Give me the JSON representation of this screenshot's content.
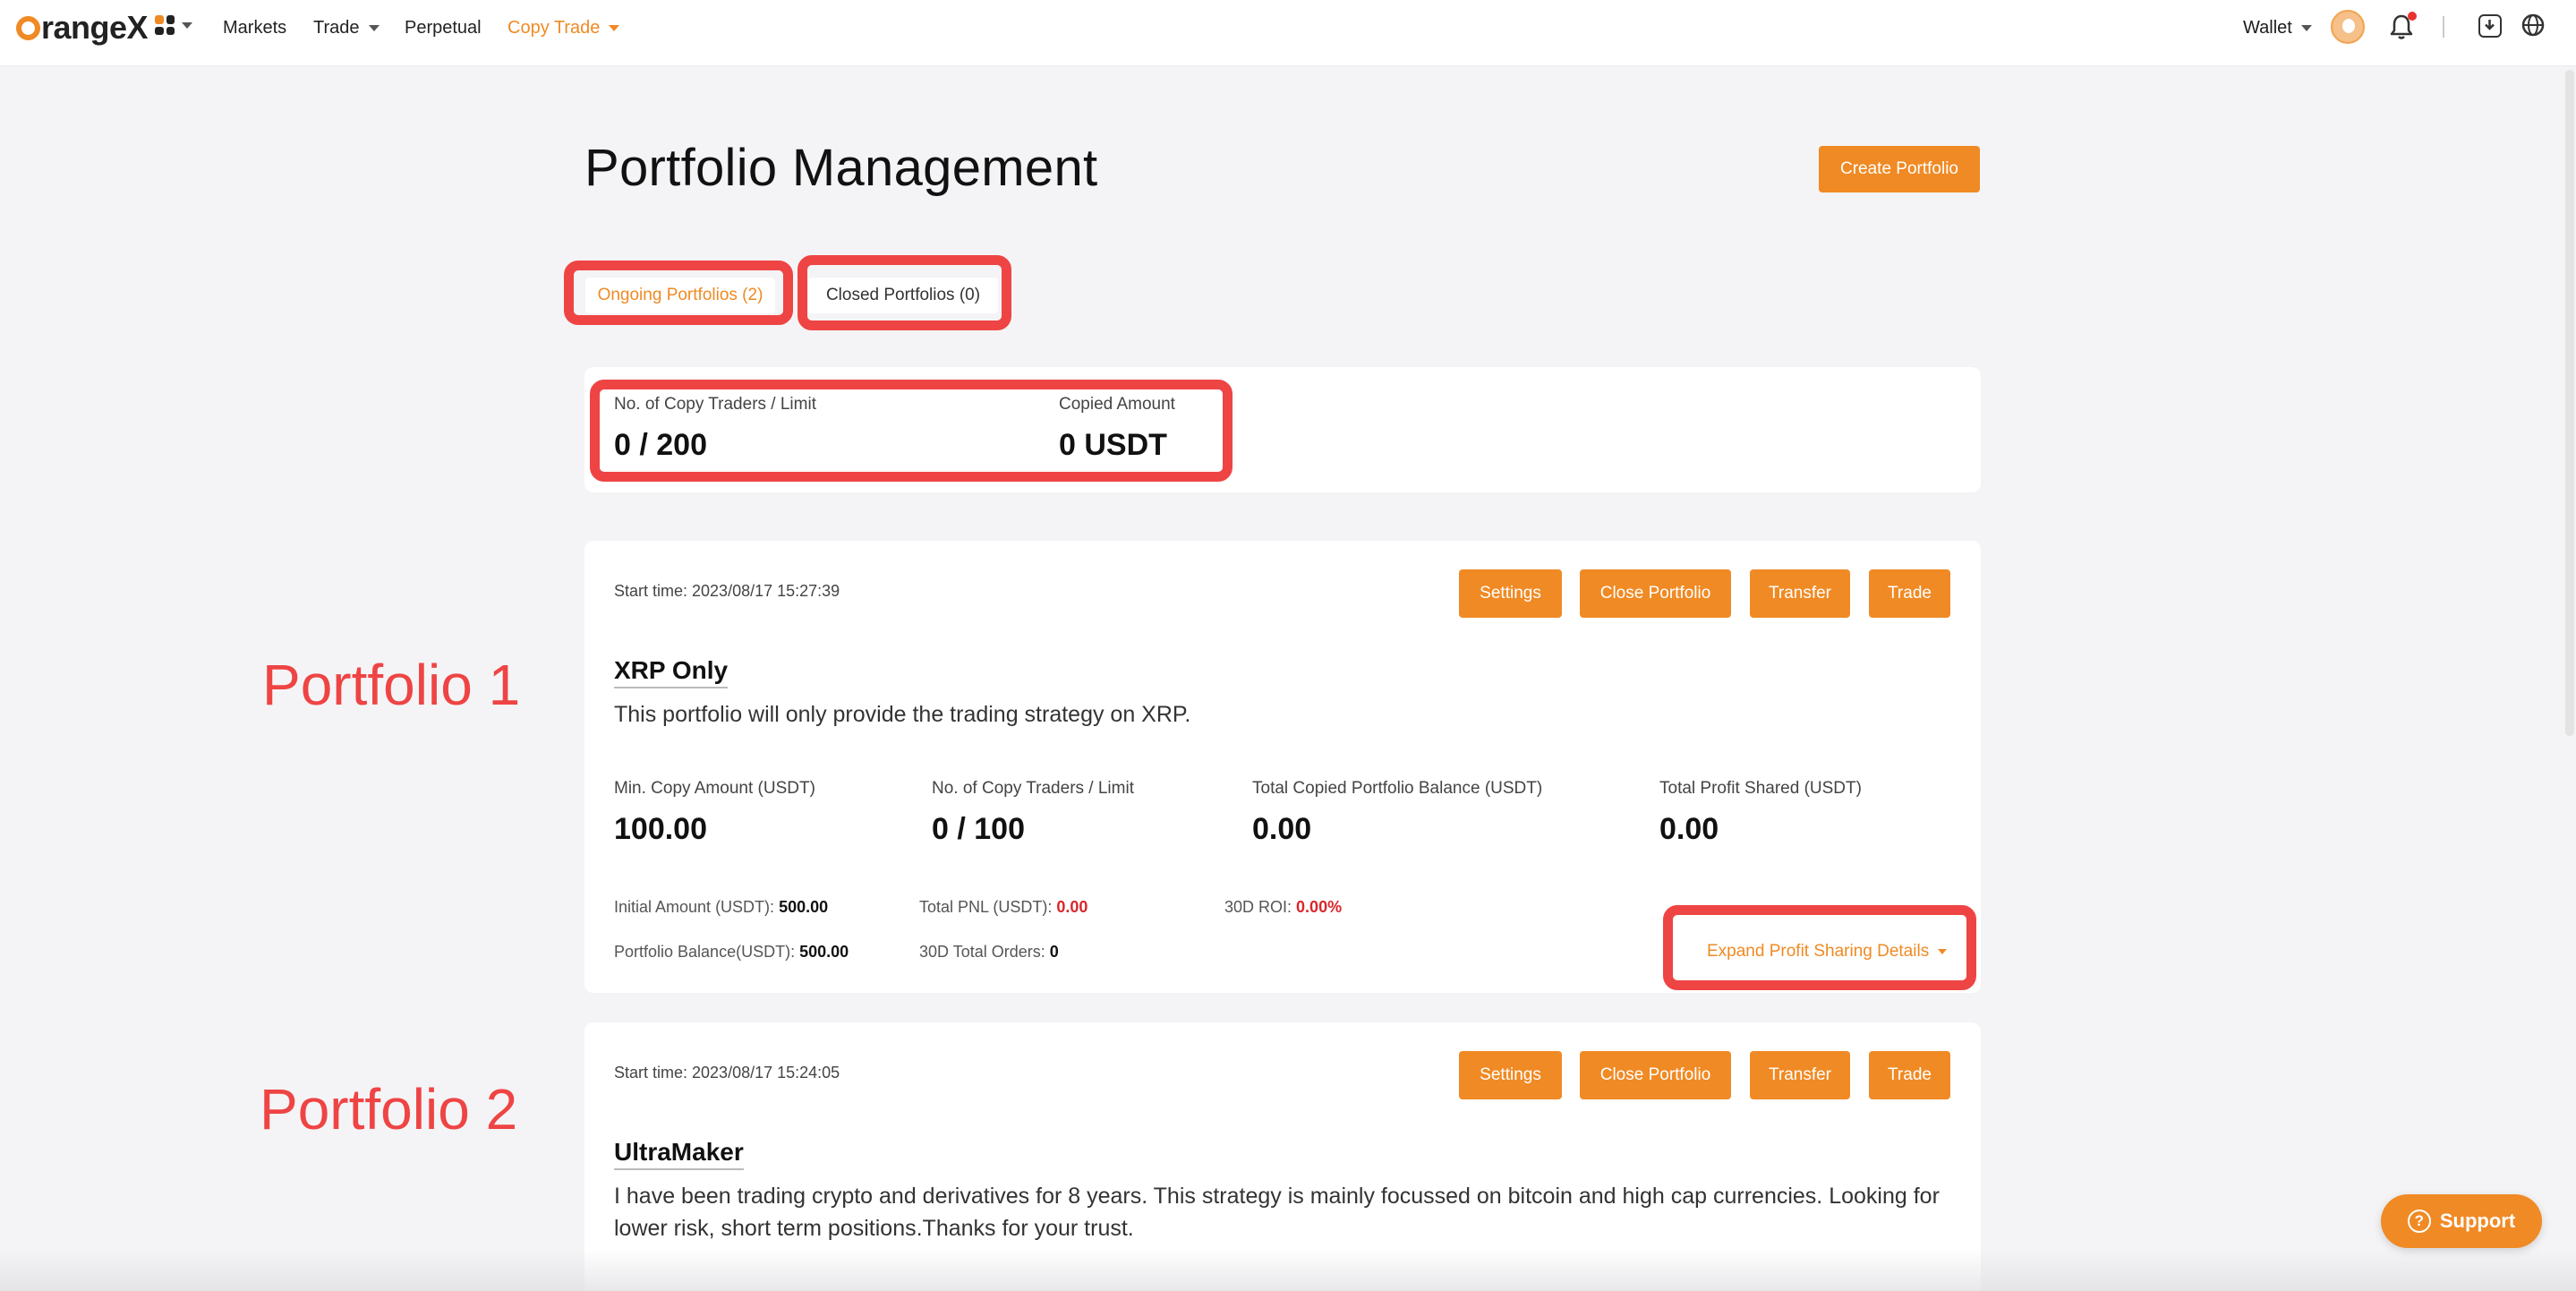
{
  "nav": {
    "logo": "rangeX",
    "items": {
      "markets": "Markets",
      "trade": "Trade",
      "perpetual": "Perpetual",
      "copy_trade": "Copy Trade"
    },
    "wallet": "Wallet",
    "accent": "#f08a24"
  },
  "page": {
    "title": "Portfolio Management",
    "create_button": "Create Portfolio"
  },
  "tabs": {
    "ongoing": "Ongoing Portfolios (2)",
    "closed": "Closed Portfolios (0)"
  },
  "summary": {
    "traders_label": "No. of Copy Traders / Limit",
    "traders_value": "0 / 200",
    "copied_label": "Copied Amount",
    "copied_value": "0 USDT"
  },
  "annotations": {
    "p1": "Portfolio 1",
    "p2": "Portfolio 2",
    "highlight_color": "#ef4444"
  },
  "portfolios": [
    {
      "start_time": "Start time: 2023/08/17 15:27:39",
      "buttons": {
        "settings": "Settings",
        "close": "Close Portfolio",
        "transfer": "Transfer",
        "trade": "Trade"
      },
      "name": "XRP Only",
      "description": "This portfolio will only provide the trading strategy on XRP.",
      "stats": {
        "min_copy_label": "Min. Copy Amount (USDT)",
        "min_copy_value": "100.00",
        "traders_label": "No. of Copy Traders / Limit",
        "traders_value": "0 / 100",
        "balance_label": "Total Copied Portfolio Balance (USDT)",
        "balance_value": "0.00",
        "profit_label": "Total Profit Shared (USDT)",
        "profit_value": "0.00"
      },
      "details": {
        "initial_label": "Initial Amount (USDT):",
        "initial_value": "500.00",
        "pnl_label": "Total PNL (USDT):",
        "pnl_value": "0.00",
        "roi_label": "30D ROI:",
        "roi_value": "0.00%",
        "pbal_label": "Portfolio Balance(USDT):",
        "pbal_value": "500.00",
        "orders_label": "30D Total Orders:",
        "orders_value": "0"
      },
      "expand": "Expand Profit Sharing Details"
    },
    {
      "start_time": "Start time: 2023/08/17 15:24:05",
      "buttons": {
        "settings": "Settings",
        "close": "Close Portfolio",
        "transfer": "Transfer",
        "trade": "Trade"
      },
      "name": "UltraMaker",
      "description_line1": "I have been trading crypto and derivatives for 8 years. This strategy is mainly focussed on bitcoin and high cap currencies. Looking for",
      "description_line2": "lower risk, short term positions.Thanks for your trust."
    }
  ],
  "support": "Support"
}
